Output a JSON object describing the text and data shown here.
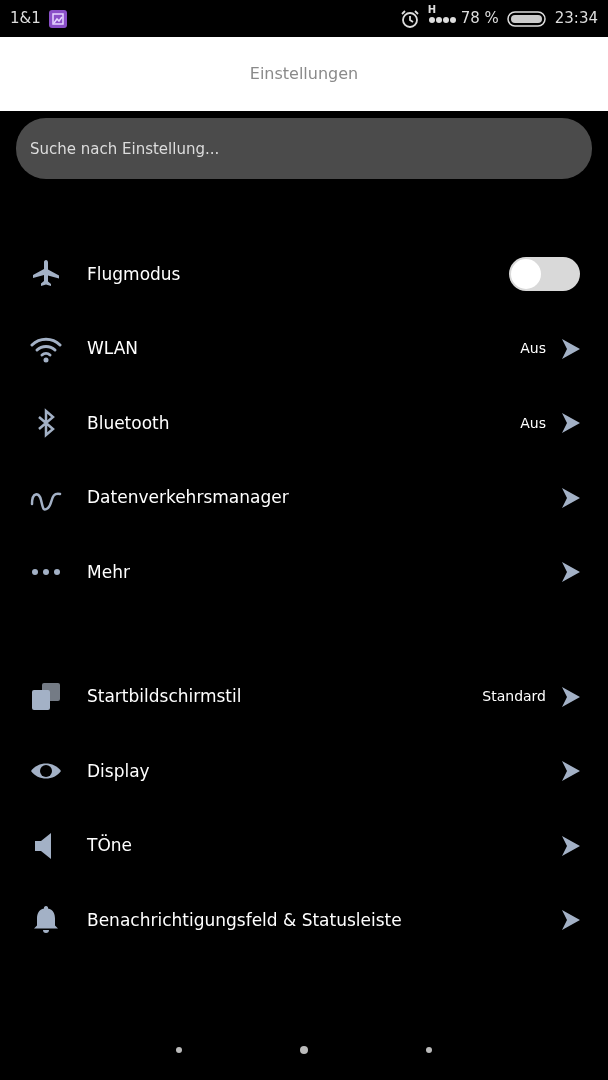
{
  "status_bar": {
    "carrier": "1&1",
    "network": "H",
    "battery": "78 %",
    "time": "23:34"
  },
  "header": {
    "title": "Einstellungen"
  },
  "search": {
    "placeholder": "Suche nach Einstellung..."
  },
  "sections": [
    {
      "items": [
        {
          "label": "Flugmodus",
          "kind": "toggle",
          "on": false
        },
        {
          "label": "WLAN",
          "kind": "link",
          "value": "Aus"
        },
        {
          "label": "Bluetooth",
          "kind": "link",
          "value": "Aus"
        },
        {
          "label": "Datenverkehrsmanager",
          "kind": "link"
        },
        {
          "label": "Mehr",
          "kind": "link"
        }
      ]
    },
    {
      "items": [
        {
          "label": "Startbildschirmstil",
          "kind": "link",
          "value": "Standard"
        },
        {
          "label": "Display",
          "kind": "link"
        },
        {
          "label": "TÖne",
          "kind": "link"
        },
        {
          "label": "Benachrichtigungsfeld & Statusleiste",
          "kind": "link"
        }
      ]
    }
  ],
  "pages": [
    {
      "selected": false
    },
    {
      "selected": true
    },
    {
      "selected": false
    }
  ]
}
